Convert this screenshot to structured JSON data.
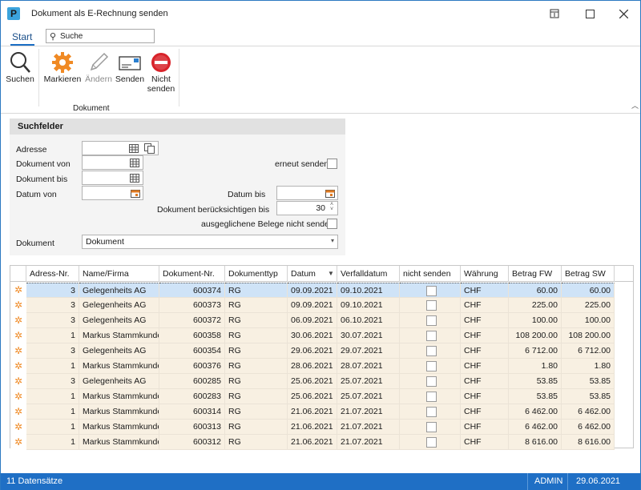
{
  "window": {
    "title": "Dokument als E-Rechnung senden"
  },
  "ribbon": {
    "tab_start": "Start",
    "search_placeholder": "Suche",
    "btn_suchen": "Suchen",
    "btn_markieren": "Markieren",
    "btn_aendern": "Ändern",
    "btn_senden": "Senden",
    "btn_nicht_1": "Nicht",
    "btn_nicht_2": "senden",
    "group_label": "Dokument"
  },
  "search": {
    "title": "Suchfelder",
    "label_adresse": "Adresse",
    "label_dok_von": "Dokument von",
    "label_dok_bis": "Dokument bis",
    "label_datum_von": "Datum von",
    "label_datum_bis": "Datum bis",
    "label_erneut": "erneut senden",
    "label_beruecksichtigen": "Dokument berücksichtigen bis",
    "beruecksichtigen_value": "30",
    "label_ausgeglichen": "ausgeglichene Belege nicht senden",
    "label_dokument": "Dokument",
    "dokument_value": "Dokument"
  },
  "grid": {
    "columns": [
      "Adress-Nr.",
      "Name/Firma",
      "Dokument-Nr.",
      "Dokumenttyp",
      "Datum",
      "Verfalldatum",
      "nicht senden",
      "Währung",
      "Betrag FW",
      "Betrag SW"
    ],
    "rows": [
      {
        "adr": "3",
        "name": "Gelegenheits AG",
        "dok": "600374",
        "typ": "RG",
        "datum": "09.09.2021",
        "verfall": "09.10.2021",
        "waehrung": "CHF",
        "fw": "60.00",
        "sw": "60.00"
      },
      {
        "adr": "3",
        "name": "Gelegenheits AG",
        "dok": "600373",
        "typ": "RG",
        "datum": "09.09.2021",
        "verfall": "09.10.2021",
        "waehrung": "CHF",
        "fw": "225.00",
        "sw": "225.00"
      },
      {
        "adr": "3",
        "name": "Gelegenheits AG",
        "dok": "600372",
        "typ": "RG",
        "datum": "06.09.2021",
        "verfall": "06.10.2021",
        "waehrung": "CHF",
        "fw": "100.00",
        "sw": "100.00"
      },
      {
        "adr": "1",
        "name": "Markus Stammkunde",
        "dok": "600358",
        "typ": "RG",
        "datum": "30.06.2021",
        "verfall": "30.07.2021",
        "waehrung": "CHF",
        "fw": "108 200.00",
        "sw": "108 200.00"
      },
      {
        "adr": "3",
        "name": "Gelegenheits AG",
        "dok": "600354",
        "typ": "RG",
        "datum": "29.06.2021",
        "verfall": "29.07.2021",
        "waehrung": "CHF",
        "fw": "6 712.00",
        "sw": "6 712.00"
      },
      {
        "adr": "1",
        "name": "Markus Stammkunde",
        "dok": "600376",
        "typ": "RG",
        "datum": "28.06.2021",
        "verfall": "28.07.2021",
        "waehrung": "CHF",
        "fw": "1.80",
        "sw": "1.80"
      },
      {
        "adr": "3",
        "name": "Gelegenheits AG",
        "dok": "600285",
        "typ": "RG",
        "datum": "25.06.2021",
        "verfall": "25.07.2021",
        "waehrung": "CHF",
        "fw": "53.85",
        "sw": "53.85"
      },
      {
        "adr": "1",
        "name": "Markus Stammkunde",
        "dok": "600283",
        "typ": "RG",
        "datum": "25.06.2021",
        "verfall": "25.07.2021",
        "waehrung": "CHF",
        "fw": "53.85",
        "sw": "53.85"
      },
      {
        "adr": "1",
        "name": "Markus Stammkunde",
        "dok": "600314",
        "typ": "RG",
        "datum": "21.06.2021",
        "verfall": "21.07.2021",
        "waehrung": "CHF",
        "fw": "6 462.00",
        "sw": "6 462.00"
      },
      {
        "adr": "1",
        "name": "Markus Stammkunde",
        "dok": "600313",
        "typ": "RG",
        "datum": "21.06.2021",
        "verfall": "21.07.2021",
        "waehrung": "CHF",
        "fw": "6 462.00",
        "sw": "6 462.00"
      },
      {
        "adr": "1",
        "name": "Markus Stammkunde",
        "dok": "600312",
        "typ": "RG",
        "datum": "21.06.2021",
        "verfall": "21.07.2021",
        "waehrung": "CHF",
        "fw": "8 616.00",
        "sw": "8 616.00"
      }
    ]
  },
  "status": {
    "records": "11 Datensätze",
    "user": "ADMIN",
    "date": "29.06.2021"
  },
  "colors": {
    "accent": "#1f6fc5",
    "row_bg": "#f8f0e2",
    "row_selected": "#cfe3f7",
    "orange_icon": "#f08a24",
    "red_icon": "#d8232a"
  }
}
